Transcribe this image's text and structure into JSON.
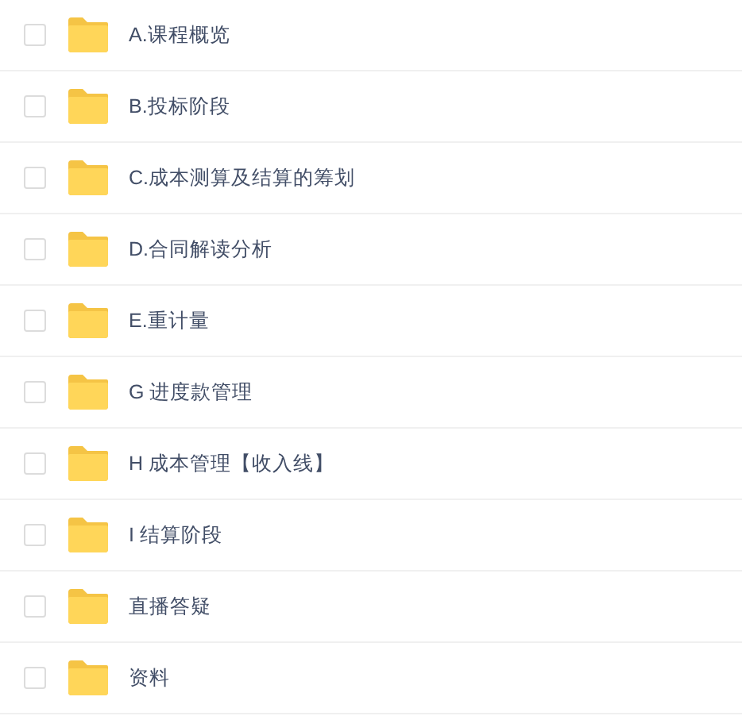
{
  "files": [
    {
      "name": "A.课程概览",
      "checked": false
    },
    {
      "name": "B.投标阶段",
      "checked": false
    },
    {
      "name": "C.成本测算及结算的筹划",
      "checked": false
    },
    {
      "name": "D.合同解读分析",
      "checked": false
    },
    {
      "name": "E.重计量",
      "checked": false
    },
    {
      "name": "G 进度款管理",
      "checked": false
    },
    {
      "name": "H 成本管理【收入线】",
      "checked": false
    },
    {
      "name": "I 结算阶段",
      "checked": false
    },
    {
      "name": "直播答疑",
      "checked": false
    },
    {
      "name": "资料",
      "checked": false
    }
  ]
}
